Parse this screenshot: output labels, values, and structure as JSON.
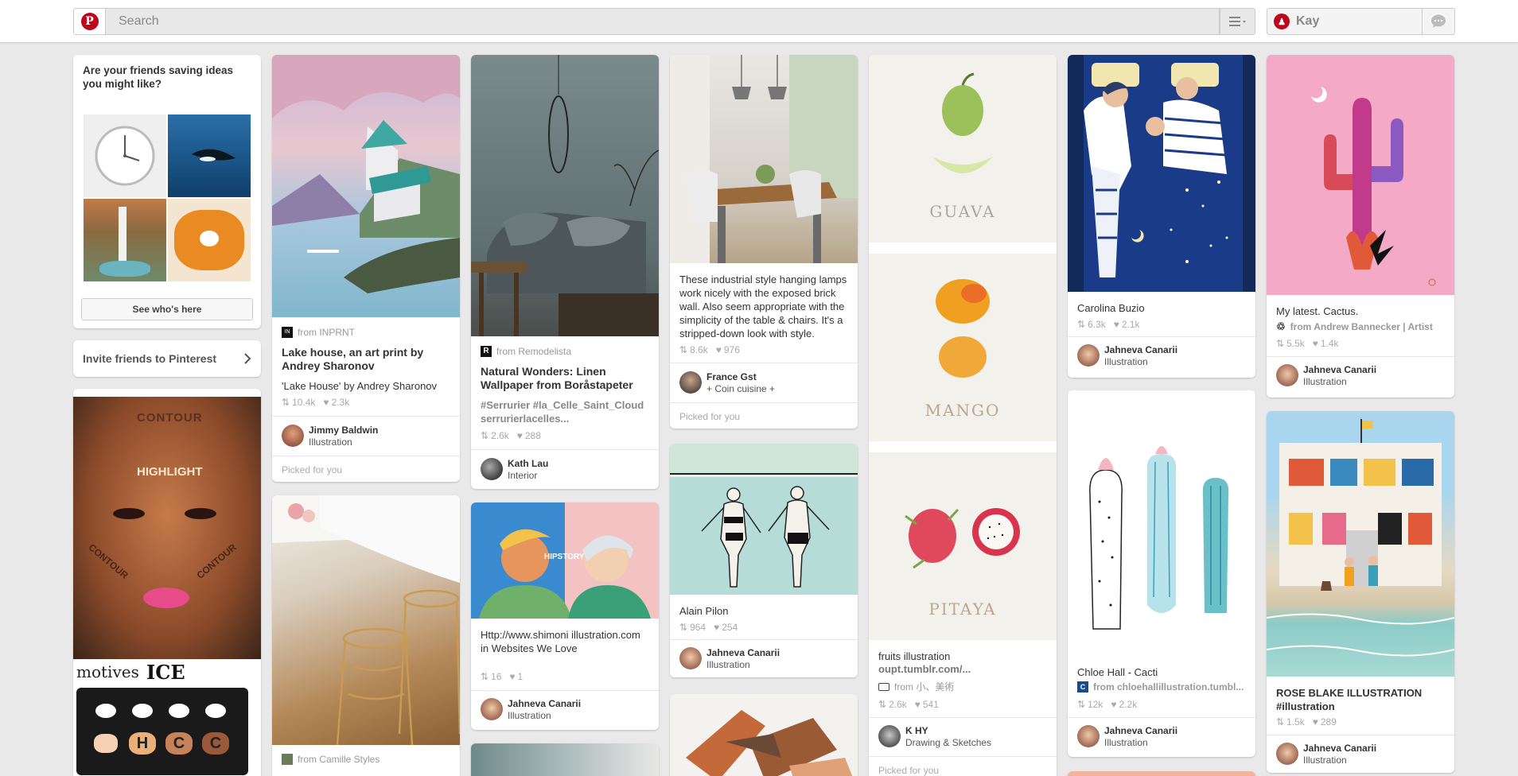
{
  "header": {
    "search_placeholder": "Search",
    "user_name": "Kay"
  },
  "sidebar": {
    "prompt_title": "Are your friends saving ideas you might like?",
    "see_button": "See who's here",
    "invite_label": "Invite friends to Pinterest"
  },
  "pins": {
    "lake": {
      "from": "from INPRNT",
      "title": "Lake house, an art print by Andrey Sharonov",
      "desc": "'Lake House' by Andrey Sharonov",
      "repins": "10.4k",
      "likes": "2.3k",
      "pinner": "Jimmy Baldwin",
      "board": "Illustration",
      "picked": "Picked for you"
    },
    "chairs": {
      "from": "from Camille Styles"
    },
    "sofa": {
      "from": "from Remodelista",
      "title": "Natural Wonders: Linen Wallpaper from Boråstapeter",
      "desc": "#Serrurier #la_Celle_Saint_Cloud serrurierlacelles...",
      "repins": "2.6k",
      "likes": "288",
      "pinner": "Kath Lau",
      "board": "Interior"
    },
    "hipstory": {
      "desc": "Http://www.shimoni illustration.com in Websites We Love",
      "repins": "16",
      "likes": "1",
      "pinner": "Jahneva Canarii",
      "board": "Illustration",
      "img_label": "HIPSTORY"
    },
    "dining": {
      "desc": "These industrial style hanging lamps work nicely with the exposed brick wall. Also seem appropriate with the simplicity of the table & chairs. It's a stripped-down look with style.",
      "repins": "8.6k",
      "likes": "976",
      "pinner": "France Gst",
      "board": "+ Coin cuisine +",
      "picked": "Picked for you"
    },
    "swim": {
      "title": "Alain Pilon",
      "repins": "964",
      "likes": "254",
      "pinner": "Jahneva Canarii",
      "board": "Illustration"
    },
    "fruits": {
      "labels": [
        "GUAVA",
        "MANGO",
        "PITAYA"
      ],
      "desc": "fruits illustration",
      "link": "oupt.tumblr.com/...",
      "from": "from 小、美術",
      "repins": "2.6k",
      "likes": "541",
      "pinner": "K HY",
      "board": "Drawing & Sketches",
      "picked": "Picked for you"
    },
    "family": {
      "title": "Carolina Buzio",
      "repins": "6.3k",
      "likes": "2.1k",
      "pinner": "Jahneva Canarii",
      "board": "Illustration"
    },
    "cacti": {
      "title": "Chloe Hall - Cacti",
      "from": "from chloehallillustration.tumbl...",
      "repins": "12k",
      "likes": "2.2k",
      "pinner": "Jahneva Canarii",
      "board": "Illustration"
    },
    "cactus": {
      "title": "My latest. Cactus.",
      "from": "from Andrew Bannecker | Artist",
      "repins": "5.5k",
      "likes": "1.4k",
      "pinner": "Jahneva Canarii",
      "board": "Illustration"
    },
    "rose": {
      "title": "ROSE BLAKE ILLUSTRATION #illustration",
      "repins": "1.5k",
      "likes": "289",
      "pinner": "Jahneva Canarii",
      "board": "Illustration"
    },
    "makeup": {
      "labels": [
        "CONTOUR",
        "HIGHLIGHT",
        "CONTOUR",
        "CONTOUR"
      ],
      "brand": "motives",
      "product": "ICE PALETTE",
      "letters": [
        "H",
        "C",
        "C"
      ]
    }
  },
  "colors": {
    "brand_red": "#bd081c",
    "background": "#e9e9e9"
  }
}
